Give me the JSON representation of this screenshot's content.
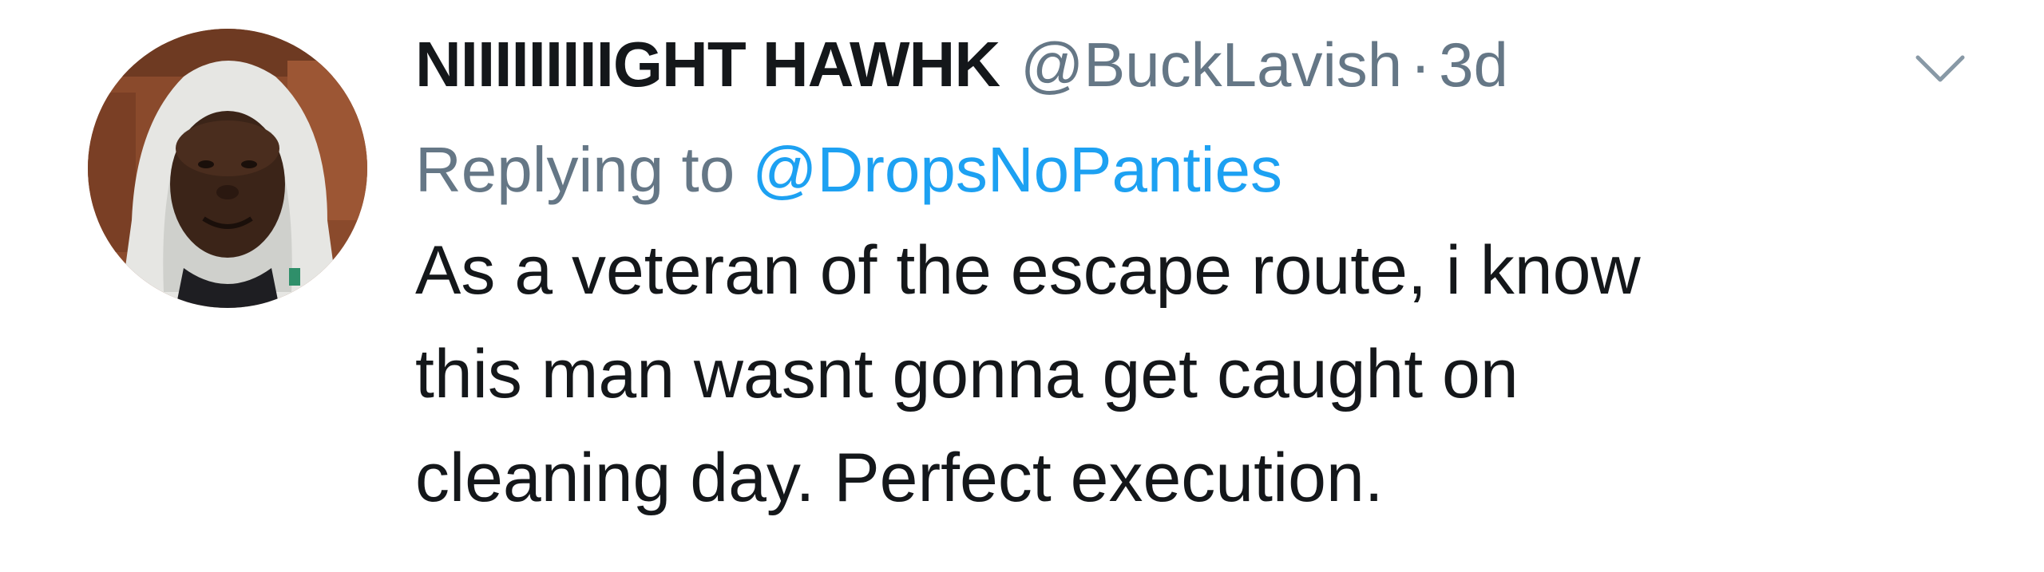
{
  "tweet": {
    "display_name": "NIIIIIIIIIGHT HAWHK",
    "handle": "@BuckLavish",
    "separator": "·",
    "time": "3d",
    "replying_prefix": "Replying to",
    "replying_handle": "@DropsNoPanties",
    "text": "As a veteran of the escape route, i know\nthis man wasnt gonna get caught on\ncleaning day. Perfect execution.",
    "avatar_icon": "profile-photo",
    "menu_icon": "chevron-down-icon"
  },
  "colors": {
    "name": "#14171a",
    "secondary": "#657786",
    "link": "#1da1f2",
    "background": "#ffffff"
  }
}
